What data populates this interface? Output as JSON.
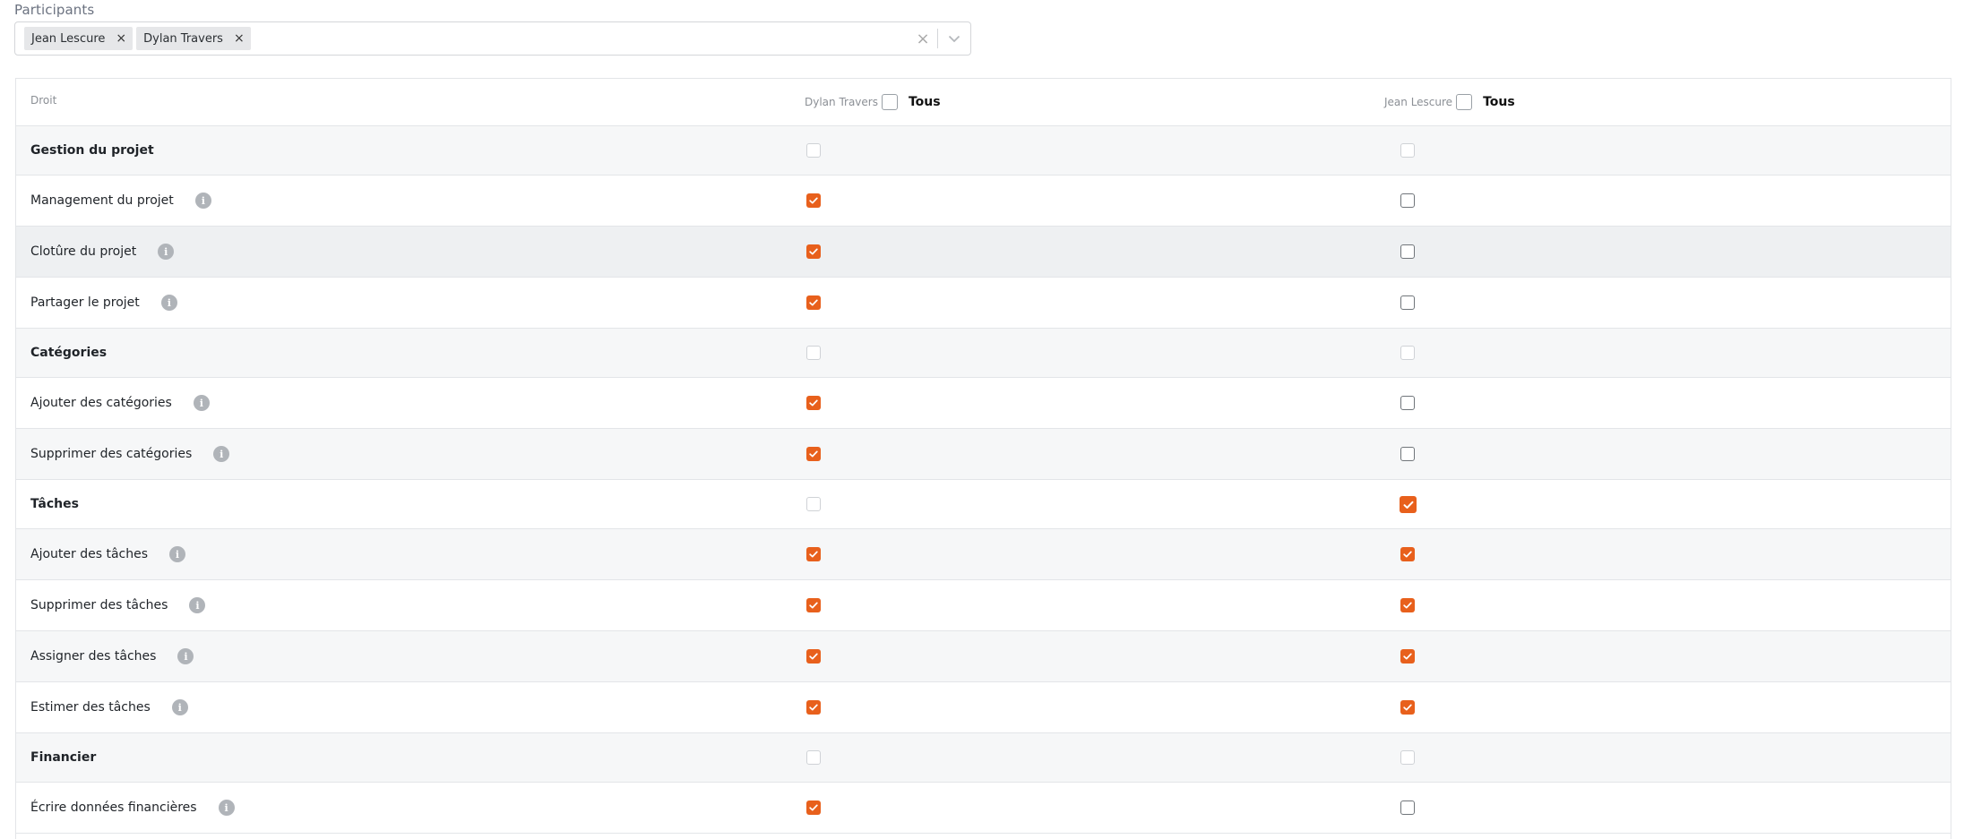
{
  "participants": {
    "label": "Participants",
    "chips": [
      {
        "label": "Jean Lescure",
        "remove": "×"
      },
      {
        "label": "Dylan Travers",
        "remove": "×"
      }
    ],
    "clear_glyph": "×",
    "icons": {
      "clear": "clear-icon",
      "dropdown": "chevron-down-icon",
      "remove": "close-icon"
    }
  },
  "table": {
    "header": {
      "droit": "Droit",
      "columns": [
        {
          "name": "Dylan Travers",
          "all_label": "Tous",
          "all_checked": false
        },
        {
          "name": "Jean Lescure",
          "all_label": "Tous",
          "all_checked": false
        }
      ]
    },
    "info_glyph": "i",
    "rows": [
      {
        "label": "Gestion du projet",
        "group": true,
        "dylan": false,
        "jean": false
      },
      {
        "label": "Management du projet",
        "group": false,
        "dylan": true,
        "jean": false
      },
      {
        "label": "Clotûre du projet",
        "group": false,
        "dylan": true,
        "jean": false
      },
      {
        "label": "Partager le projet",
        "group": false,
        "dylan": true,
        "jean": false
      },
      {
        "label": "Catégories",
        "group": true,
        "dylan": false,
        "jean": false
      },
      {
        "label": "Ajouter des catégories",
        "group": false,
        "dylan": true,
        "jean": false
      },
      {
        "label": "Supprimer des catégories",
        "group": false,
        "dylan": true,
        "jean": false
      },
      {
        "label": "Tâches",
        "group": true,
        "dylan": false,
        "jean": true
      },
      {
        "label": "Ajouter des tâches",
        "group": false,
        "dylan": true,
        "jean": true
      },
      {
        "label": "Supprimer des tâches",
        "group": false,
        "dylan": true,
        "jean": true
      },
      {
        "label": "Assigner des tâches",
        "group": false,
        "dylan": true,
        "jean": true
      },
      {
        "label": "Estimer des tâches",
        "group": false,
        "dylan": true,
        "jean": true
      },
      {
        "label": "Financier",
        "group": true,
        "dylan": false,
        "jean": false
      },
      {
        "label": "Écrire données financières",
        "group": false,
        "dylan": true,
        "jean": false
      }
    ]
  },
  "colors": {
    "accent": "#e8601c",
    "row_alt": "#f6f7f8",
    "border": "#e3e5e8"
  }
}
